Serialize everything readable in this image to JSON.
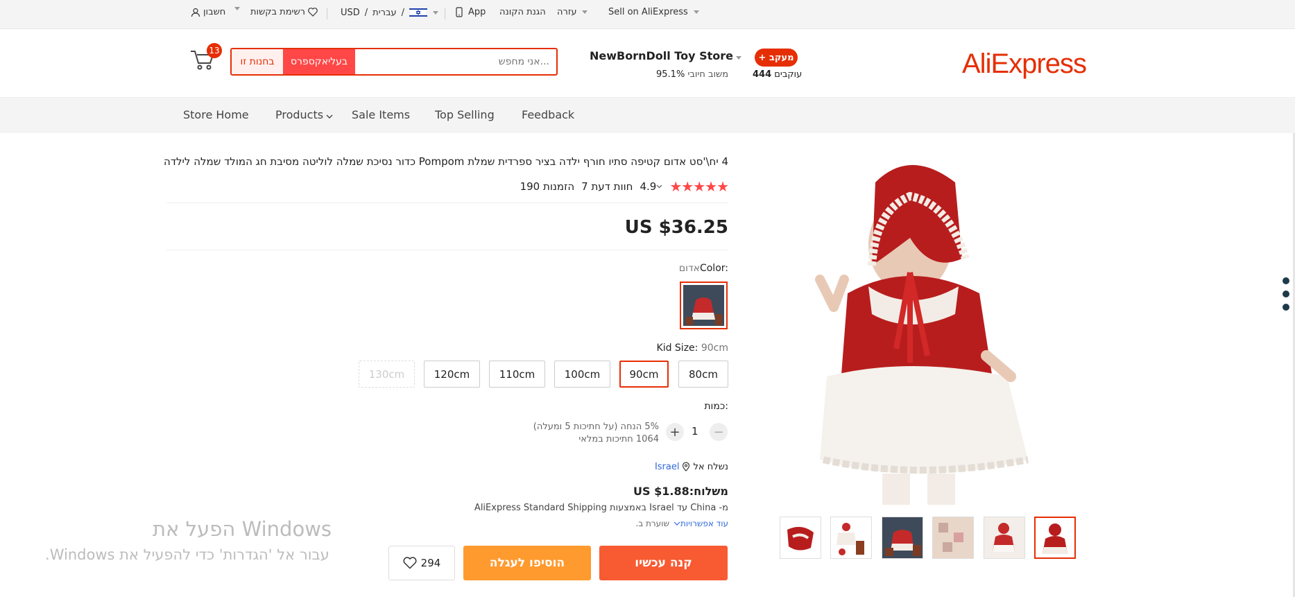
{
  "topbar": {
    "account": "חשבון",
    "wishlist": "רשימת בקשות",
    "currency": "USD",
    "language": "עברית",
    "slash": "/",
    "app": "App",
    "buyer_protection": "הגנת הקונה",
    "help": "עזרה",
    "sell": "Sell on AliExpress"
  },
  "header": {
    "logo": "AliExpress",
    "follow_button": "+ מעקב",
    "followers_count": "444",
    "followers_label": "עוקבים",
    "store_name": "NewBornDoll Toy Store",
    "feedback_percent": "95.1%",
    "feedback_label": "משוב חיובי",
    "search_placeholder": "...אני מחפש",
    "search_aliexpress": "בעליאקספרס",
    "search_store": "בחנות זו",
    "cart_count": "13"
  },
  "nav": {
    "tabs": [
      "Store Home",
      "Products",
      "Sale Items",
      "Top Selling",
      "Feedback"
    ]
  },
  "product": {
    "title": "4 יח\\'סט אדום קטיפה סתיו חורף ילדה בציר ספרדית שמלת Pompom כדור נסיכת שמלה לוליטה מסיבת חג המולד שמלה לילדה",
    "stars": "★★★★★",
    "rating": "4.9",
    "reviews": "7 חוות דעת",
    "orders": "190 הזמנות",
    "price": "US $36.25",
    "color_label": "Color:",
    "color_value": "אדום",
    "size_label": "Kid Size:",
    "size_value": "90cm",
    "sizes": [
      "80cm",
      "90cm",
      "100cm",
      "110cm",
      "120cm",
      "130cm"
    ],
    "quantity_label": "כמות:",
    "quantity": "1",
    "discount": "5% הנחה (על חתיכות 5 ומעלה)",
    "stock": "1064 חתיכות במלאי",
    "ship_to_label": "נשלח אל",
    "ship_to_country": "Israel",
    "shipping_price": "משלוח:US $1.88",
    "shipping_method": "מ- China עד Israel באמצעות AliExpress Standard Shipping",
    "more_options": "עוד אפשרויות",
    "estimated": "שוערת ב.",
    "buy_now": "קנה עכשיו",
    "add_to_cart": "הוסיפו לעגלה",
    "wish_count": "294"
  },
  "watermark": {
    "line1": "הפעל את Windows",
    "line2": "עבור אל 'הגדרות' כדי להפעיל את Windows."
  },
  "colors": {
    "brand": "#e62e04",
    "buy": "#f85a32",
    "cart": "#ff9a2e"
  }
}
